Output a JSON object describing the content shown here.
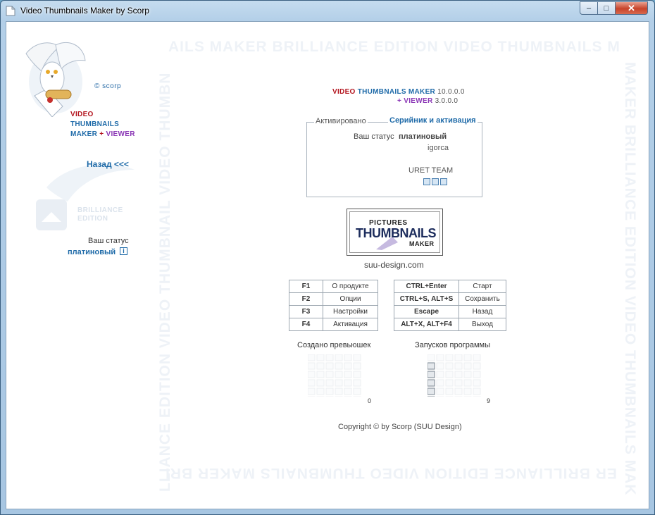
{
  "window": {
    "title": "Video Thumbnails Maker by Scorp",
    "min_glyph": "–",
    "max_glyph": "□",
    "close_glyph": "✕"
  },
  "watermark": {
    "top": "AILS MAKER BRILLIANCE EDITION VIDEO THUMBNAILS M",
    "right": "MAKER BRILLIANCE EDITION VIDEO THUMBNAILS MAK",
    "bottom": "ER BRILLIANCE EDITION VIDEO THUMBNAILS MAKER BRI",
    "left": "LLIANCE EDITION VIDEO THUMBNAIL VIDEO THUMBN"
  },
  "sidebar": {
    "copyright_small": "© scorp",
    "logo_video": "VIDEO",
    "logo_thumbnails": "THUMBNAILS",
    "logo_maker": "MAKER",
    "logo_plus": "+",
    "logo_viewer": "VIEWER",
    "back_link": "Назад <<<",
    "edition_line1": "BRILLIANCE",
    "edition_line2": "EDITION",
    "status_label": "Ваш статус",
    "status_value": "платиновый",
    "info_glyph": "i"
  },
  "versions": {
    "video": "VIDEO",
    "thumbnails_maker": "THUMBNAILS MAKER",
    "vtm_version": "10.0.0.0",
    "plus_viewer": "+ VIEWER",
    "viewer_version": "3.0.0.0"
  },
  "activation": {
    "legend": "Активировано",
    "serial_link": "Серийник и активация",
    "status_label": "Ваш статус",
    "status_value": "платиновый",
    "user": "igorca",
    "team": "URET TEAM"
  },
  "pictures_logo": {
    "line1": "PICTURES",
    "line2": "THUMBNAILS",
    "line3": "MAKER",
    "site": "suu-design.com"
  },
  "shortcuts_left": [
    {
      "key": "F1",
      "action": "О продукте"
    },
    {
      "key": "F2",
      "action": "Опции"
    },
    {
      "key": "F3",
      "action": "Настройки"
    },
    {
      "key": "F4",
      "action": "Активация"
    }
  ],
  "shortcuts_right": [
    {
      "key": "CTRL+Enter",
      "action": "Старт"
    },
    {
      "key": "CTRL+S, ALT+S",
      "action": "Сохранить"
    },
    {
      "key": "Escape",
      "action": "Назад"
    },
    {
      "key": "ALT+X, ALT+F4",
      "action": "Выход"
    }
  ],
  "counters": {
    "thumbs_title": "Создано превьюшек",
    "thumbs_value": "0",
    "thumbs_level": 0,
    "runs_title": "Запусков программы",
    "runs_value": "9",
    "runs_level": 5,
    "bar_colors": [
      "#6b7c8e",
      "#4a6fb0",
      "#c0504d",
      "#9bbb59",
      "#4bacc6",
      "#8064a2"
    ]
  },
  "footer": {
    "copyright": "Copyright © by Scorp (SUU Design)"
  }
}
